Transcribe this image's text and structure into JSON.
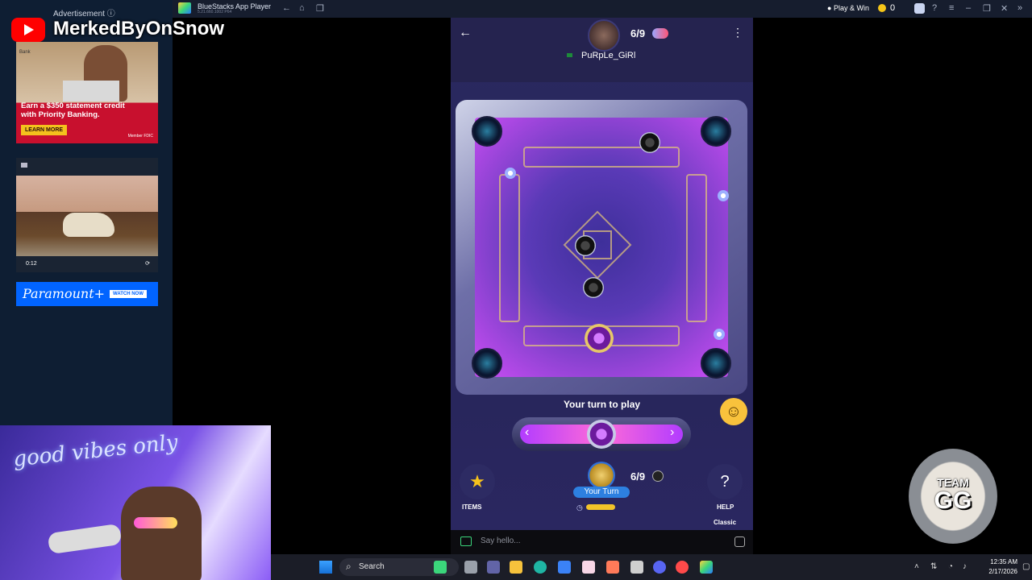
{
  "channel": {
    "name": "MerkedByOnSnow"
  },
  "ad_sidebar": {
    "label": "Advertisement ⓘ",
    "bank_ad": {
      "copy": "Earn a $350 statement credit with Priority Banking.",
      "cta": "LEARN MORE",
      "footer": "Member FDIC",
      "brand": "Bank"
    },
    "video_ad": {
      "time": "0:12",
      "expand": "⟳"
    },
    "paramount_ad": {
      "logo": "Paramount+",
      "cta": "WATCH NOW"
    }
  },
  "titlebar": {
    "app_title": "BlueStacks App Player",
    "version": "5.21.660.1002 P64",
    "play_win": "Play & Win",
    "coins": "0"
  },
  "game": {
    "opponent": {
      "name": "PuRpLe_GiRl",
      "score": "6/9"
    },
    "turn_text": "Your turn to play",
    "player": {
      "score": "6/9",
      "badge": "Your Turn"
    },
    "items_label": "ITEMS",
    "help_label": "HELP",
    "mode_label": "Classic",
    "icons": {
      "back": "←",
      "menu": "⋮",
      "items": "★",
      "help": "?",
      "emoji": "☺",
      "timer": "◷",
      "left": "‹",
      "right": "›"
    }
  },
  "chat": {
    "placeholder": "Say hello..."
  },
  "overlay": {
    "team_top": "TEAM",
    "team_main": "GG"
  },
  "webcam": {
    "neon_text": "good vibes only"
  },
  "taskbar": {
    "search_label": "Search",
    "time": "12:35 AM",
    "date": "2/17/2026"
  },
  "colors": {
    "accent": "#b23cff",
    "brand_red": "#ff0000",
    "bluestacks_bar": "#161d2e"
  }
}
